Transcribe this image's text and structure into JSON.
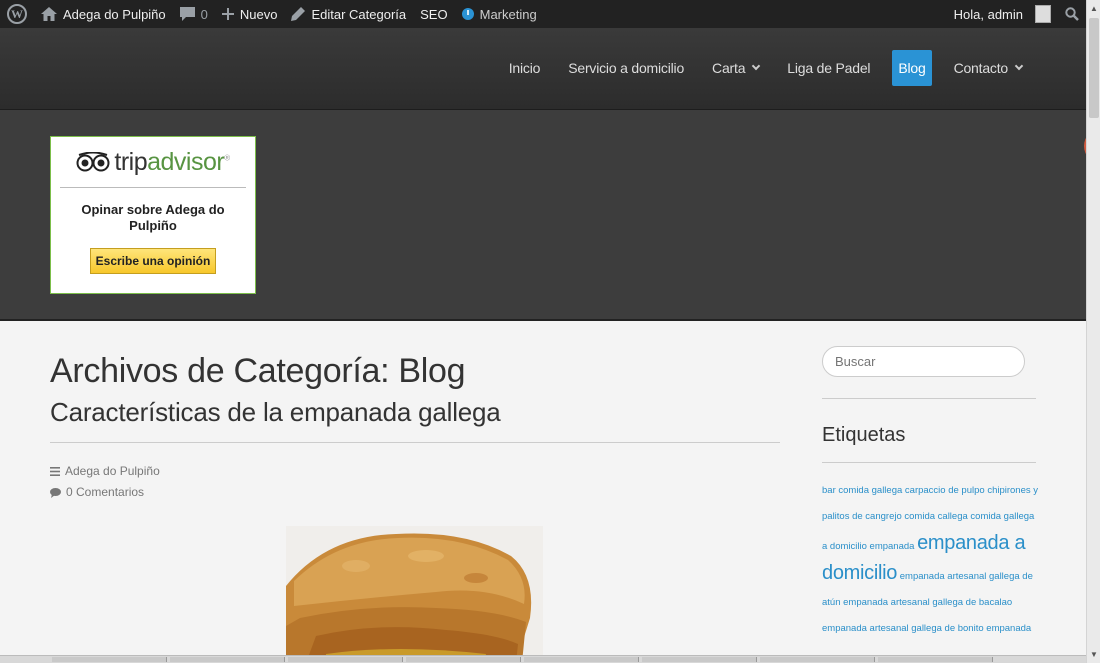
{
  "adminbar": {
    "site_name": "Adega do Pulpiño",
    "comments_count": "0",
    "new_label": "Nuevo",
    "edit_label": "Editar Categoría",
    "seo_label": "SEO",
    "marketing_label": "Marketing",
    "greeting": "Hola, admin"
  },
  "nav": {
    "items": [
      {
        "label": "Inicio"
      },
      {
        "label": "Servicio a domicilio"
      },
      {
        "label": "Carta"
      },
      {
        "label": "Liga de Padel"
      },
      {
        "label": "Blog"
      },
      {
        "label": "Contacto"
      }
    ],
    "active": "Blog"
  },
  "tripadvisor": {
    "logo_trip": "trip",
    "logo_advisor": "advisor",
    "logo_mark": "®",
    "text": "Opinar sobre Adega do Pulpiño",
    "button": "Escribe una opinión"
  },
  "main": {
    "archive_title": "Archivos de Categoría: Blog",
    "post_title": "Características de la empanada gallega",
    "author": "Adega do Pulpiño",
    "comments": "0 Comentarios"
  },
  "sidebar": {
    "search_placeholder": "Buscar",
    "tags_title": "Etiquetas",
    "tags": {
      "t1": "bar comida gallega",
      "t2": "carpaccio de pulpo",
      "t3": "chipirones y palitos de cangrejo",
      "t4": "comida callega",
      "t5": "comida gallega a domicilio",
      "t6": "empanada",
      "t7": "empanada a domicilio",
      "t8": "empanada artesanal gallega de atún",
      "t9": "empanada artesanal gallega de bacalao",
      "t10": "empanada artesanal gallega de bonito",
      "t11": "empanada"
    }
  },
  "colors": {
    "accent": "#2a93d5",
    "tag_link": "#2a8fc9",
    "header_bg": "#333333",
    "tripadvisor_green": "#589442"
  }
}
